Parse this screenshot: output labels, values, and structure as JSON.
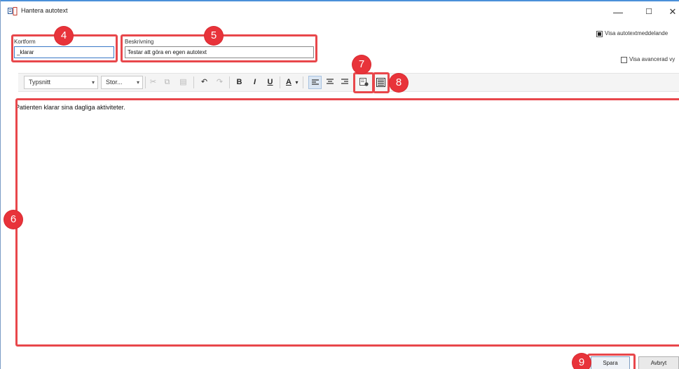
{
  "window": {
    "title": "Hantera autotext",
    "minimize_glyph": "—",
    "maximize_glyph": "☐",
    "close_glyph": "✕"
  },
  "form": {
    "kortform_label": "Kortform",
    "kortform_value": "_klarar",
    "beskrivning_label": "Beskrivning",
    "beskrivning_value": "Testar att göra en egen autotext",
    "visa_meddelande_label": "Visa autotextmeddelande",
    "visa_meddelande_checked": true,
    "visa_avancerad_label": "Visa avancerad vy",
    "visa_avancerad_checked": false
  },
  "toolbar": {
    "font_family": "Typsnitt",
    "font_size": "Stor...",
    "cut_icon": "scissors-icon",
    "copy_icon": "copy-icon",
    "paste_icon": "paste-icon",
    "undo_icon": "undo-icon",
    "redo_icon": "redo-icon",
    "bold": "B",
    "italic": "I",
    "underline": "U",
    "font_color": "A",
    "align_left_icon": "align-left-icon",
    "align_center_icon": "align-center-icon",
    "align_right_icon": "align-right-icon",
    "insert_field_icon": "insert-field-icon",
    "insert_list_icon": "insert-list-icon"
  },
  "editor": {
    "content": "Patienten klarar sina dagliga aktiviteter."
  },
  "buttons": {
    "save": "Spara",
    "cancel": "Avbryt"
  },
  "annotations": [
    {
      "number": "4"
    },
    {
      "number": "5"
    },
    {
      "number": "6"
    },
    {
      "number": "7"
    },
    {
      "number": "8"
    },
    {
      "number": "9"
    }
  ],
  "colors": {
    "annotation_red": "#e8474b",
    "window_accent": "#4a90d9"
  }
}
